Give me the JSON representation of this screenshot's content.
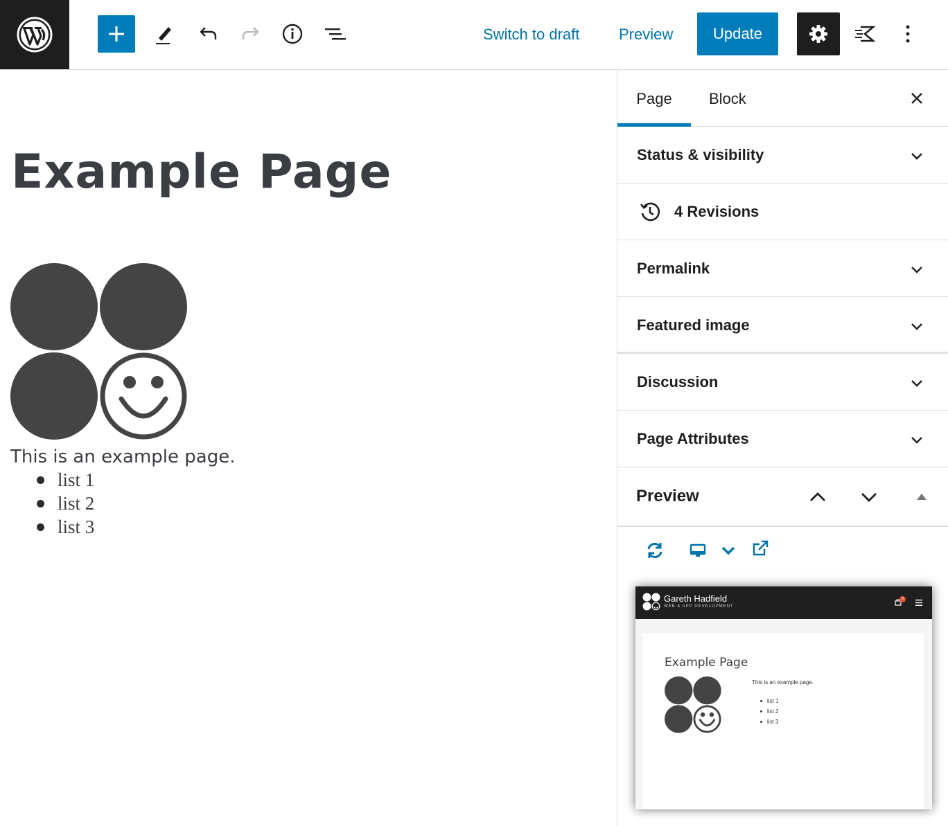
{
  "toolbar": {
    "switch_to_draft": "Switch to draft",
    "preview": "Preview",
    "update": "Update"
  },
  "editor": {
    "title": "Example Page",
    "paragraph": "This is an example page.",
    "list": [
      "list 1",
      "list 2",
      "list 3"
    ]
  },
  "sidebar": {
    "tabs": {
      "page": "Page",
      "block": "Block"
    },
    "panels": {
      "status": "Status & visibility",
      "revisions": "4 Revisions",
      "permalink": "Permalink",
      "featured_image": "Featured image",
      "discussion": "Discussion",
      "page_attributes": "Page Attributes"
    },
    "preview": {
      "label": "Preview",
      "site_name": "Gareth Hadfield",
      "site_tagline": "WEB & APP DEVELOPMENT",
      "cart_count": "0",
      "page_title": "Example Page",
      "paragraph": "This is an example page.",
      "list": [
        "list 1",
        "list 2",
        "list 3"
      ]
    }
  },
  "colors": {
    "accent": "#007cba",
    "dark": "#1e1e1e",
    "logo_gray": "#444444"
  }
}
